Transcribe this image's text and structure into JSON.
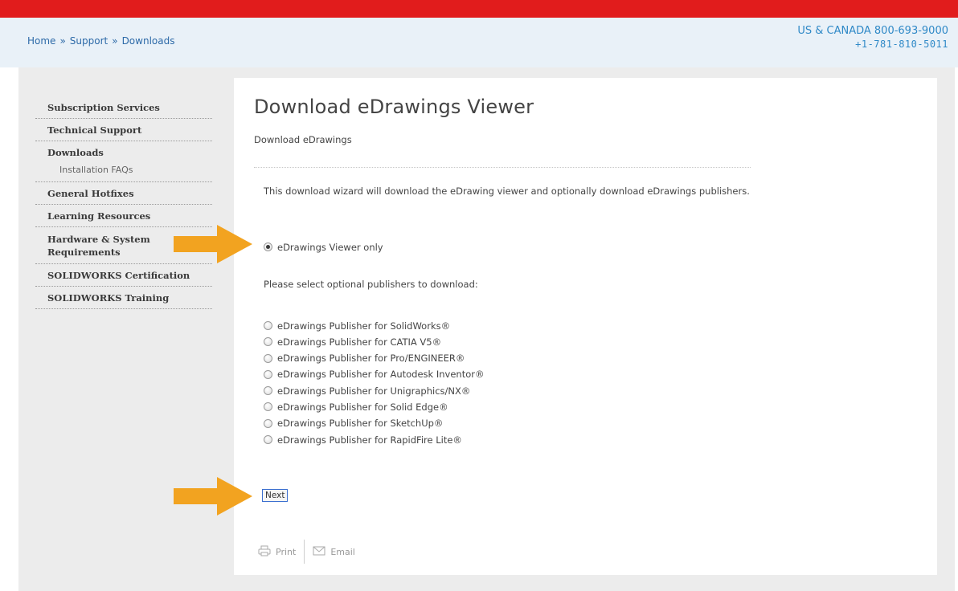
{
  "breadcrumb": [
    "Home",
    "Support",
    "Downloads"
  ],
  "breadcrumb_sep": "»",
  "contact": {
    "line1": "US & CANADA 800-693-9000",
    "line2": "+1-781-810-5011"
  },
  "sidebar": {
    "items": [
      {
        "label": "Subscription Services"
      },
      {
        "label": "Technical Support"
      },
      {
        "label": "Downloads"
      },
      {
        "label": "Installation FAQs"
      },
      {
        "label": "General Hotfixes"
      },
      {
        "label": "Learning Resources"
      },
      {
        "label": "Hardware & System Requirements"
      },
      {
        "label": "SOLIDWORKS Certification"
      },
      {
        "label": "SOLIDWORKS Training"
      }
    ]
  },
  "content": {
    "title": "Download eDrawings Viewer",
    "subtitle": "Download eDrawings",
    "intro": "This download wizard will download the eDrawing viewer and optionally download eDrawings publishers.",
    "viewer_option": {
      "label": "eDrawings Viewer only",
      "checked": true
    },
    "publishers_heading": "Please select optional publishers to download:",
    "publishers": [
      "eDrawings Publisher for SolidWorks®",
      "eDrawings Publisher for CATIA V5®",
      "eDrawings Publisher for Pro/ENGINEER®",
      "eDrawings Publisher for Autodesk Inventor®",
      "eDrawings Publisher for Unigraphics/NX®",
      "eDrawings Publisher for Solid Edge®",
      "eDrawings Publisher for SketchUp®",
      "eDrawings Publisher for RapidFire Lite®"
    ],
    "next_label": "Next",
    "print_label": "Print",
    "email_label": "Email"
  },
  "colors": {
    "top_bar": "#e11c1c",
    "header_bg": "#e9f1f8",
    "link": "#2d6aa8",
    "phone": "#2f89c7",
    "arrow": "#f2a320"
  },
  "icons": [
    "printer-icon",
    "envelope-icon",
    "arrow-right-icon"
  ]
}
